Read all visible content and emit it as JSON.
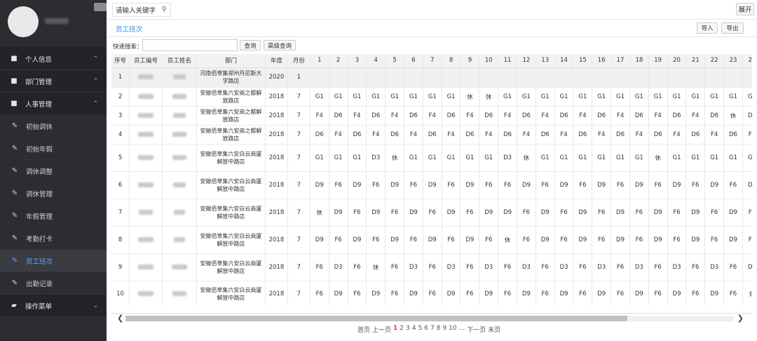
{
  "sidebar": {
    "items": [
      {
        "label": "个人信息",
        "icon": "folder-icon",
        "chev": "⌃",
        "type": "group"
      },
      {
        "label": "部门管理",
        "icon": "folder-icon",
        "chev": "⌃",
        "type": "group"
      },
      {
        "label": "人事管理",
        "icon": "folder-icon",
        "chev": "⌃",
        "type": "group"
      },
      {
        "label": "初始调休",
        "icon": "edit-icon",
        "type": "sub"
      },
      {
        "label": "初始年假",
        "icon": "edit-icon",
        "type": "sub"
      },
      {
        "label": "调休调整",
        "icon": "edit-icon",
        "type": "sub"
      },
      {
        "label": "调休管理",
        "icon": "edit-icon",
        "type": "sub"
      },
      {
        "label": "年假管理",
        "icon": "edit-icon",
        "type": "sub"
      },
      {
        "label": "考勤打卡",
        "icon": "edit-icon",
        "type": "sub"
      },
      {
        "label": "员工班次",
        "icon": "edit-icon",
        "type": "sub",
        "active": true
      },
      {
        "label": "出勤记录",
        "icon": "edit-icon",
        "type": "sub"
      },
      {
        "label": "操作菜单",
        "icon": "folder-open-icon",
        "chev": "⌄",
        "type": "group"
      }
    ]
  },
  "topbar": {
    "search_placeholder": "请输入关键字",
    "expand_label": "展开"
  },
  "tab": {
    "label": "员工班次",
    "import_label": "导入",
    "export_label": "导出"
  },
  "quick_search": {
    "label": "快速搜索：",
    "query_label": "查询",
    "advanced_label": "高级查询"
  },
  "table": {
    "headers": [
      "序号",
      "员工编号",
      "员工姓名",
      "部门",
      "年度",
      "月份",
      "1",
      "2",
      "3",
      "4",
      "5",
      "6",
      "7",
      "8",
      "9",
      "10",
      "11",
      "12",
      "13",
      "14",
      "15",
      "16",
      "17",
      "18",
      "19",
      "20",
      "21",
      "22",
      "23",
      "24"
    ],
    "rows": [
      {
        "no": "1",
        "dept": "河南佰草集郑州丹尼斯大学路店",
        "year": "2020",
        "month": "1",
        "days": []
      },
      {
        "no": "2",
        "dept": "安徽佰草集六安商之都解放路店",
        "year": "2018",
        "month": "7",
        "days": [
          "G1",
          "G1",
          "G1",
          "G1",
          "G1",
          "G1",
          "G1",
          "G1",
          "休",
          "休",
          "G1",
          "G1",
          "G1",
          "G1",
          "G1",
          "G1",
          "G1",
          "G1",
          "G1",
          "G1",
          "G1",
          "G1",
          "G1",
          "G1"
        ]
      },
      {
        "no": "3",
        "dept": "安徽佰草集六安商之都解放路店",
        "year": "2018",
        "month": "7",
        "days": [
          "F4",
          "D6",
          "F4",
          "D6",
          "F4",
          "D6",
          "F4",
          "D6",
          "F4",
          "D6",
          "F4",
          "D6",
          "F4",
          "D6",
          "F4",
          "D6",
          "F4",
          "D6",
          "F4",
          "D6",
          "F4",
          "D6",
          "休",
          "D6"
        ]
      },
      {
        "no": "4",
        "dept": "安徽佰草集六安商之都解放路店",
        "year": "2018",
        "month": "7",
        "days": [
          "D6",
          "F4",
          "D6",
          "F4",
          "D6",
          "F4",
          "D6",
          "F4",
          "D6",
          "F4",
          "D6",
          "F4",
          "D6",
          "F4",
          "D6",
          "F4",
          "D6",
          "F4",
          "D6",
          "F4",
          "D6",
          "F4",
          "D6",
          "F4"
        ]
      },
      {
        "no": "5",
        "dept": "安徽佰草集六安白云商厦解放中路店",
        "year": "2018",
        "month": "7",
        "days": [
          "G1",
          "G1",
          "G1",
          "D3",
          "休",
          "G1",
          "G1",
          "G1",
          "G1",
          "G1",
          "D3",
          "休",
          "G1",
          "G1",
          "G1",
          "G1",
          "G1",
          "G1",
          "休",
          "G1",
          "G1",
          "G1",
          "G1",
          "G1"
        ]
      },
      {
        "no": "6",
        "dept": "安徽佰草集六安白云商厦解放中路店",
        "year": "2018",
        "month": "7",
        "days": [
          "D9",
          "F6",
          "D9",
          "F6",
          "D9",
          "F6",
          "D9",
          "F6",
          "D9",
          "F6",
          "F6",
          "D9",
          "F6",
          "D9",
          "F6",
          "D9",
          "F6",
          "D9",
          "F6",
          "D9",
          "F6",
          "D9",
          "F6",
          "D9"
        ]
      },
      {
        "no": "7",
        "dept": "安徽佰草集六安白云商厦解放中路店",
        "year": "2018",
        "month": "7",
        "days": [
          "休",
          "D9",
          "F6",
          "D9",
          "F6",
          "D9",
          "F6",
          "D9",
          "F6",
          "D9",
          "D9",
          "F6",
          "D9",
          "F6",
          "D9",
          "F6",
          "D9",
          "F6",
          "D9",
          "F6",
          "D9",
          "F6",
          "D9",
          "F6"
        ]
      },
      {
        "no": "8",
        "dept": "安徽佰草集六安白云商厦解放中路店",
        "year": "2018",
        "month": "7",
        "days": [
          "D9",
          "F6",
          "D9",
          "F6",
          "D9",
          "F6",
          "D9",
          "F6",
          "D9",
          "F6",
          "休",
          "F6",
          "D9",
          "F6",
          "D9",
          "F6",
          "D9",
          "F6",
          "D9",
          "F6",
          "D9",
          "F6",
          "D9",
          "F6"
        ]
      },
      {
        "no": "9",
        "dept": "安徽佰草集六安白云商厦解放中路店",
        "year": "2018",
        "month": "7",
        "days": [
          "F6",
          "D3",
          "F6",
          "休",
          "F6",
          "D3",
          "F6",
          "D3",
          "F6",
          "D3",
          "F6",
          "D3",
          "F6",
          "D3",
          "F6",
          "D3",
          "F6",
          "D3",
          "F6",
          "D3",
          "F6",
          "D3",
          "F6",
          "D3"
        ]
      },
      {
        "no": "10",
        "dept": "安徽佰草集六安白云商厦解放中路店",
        "year": "2018",
        "month": "7",
        "days": [
          "F6",
          "D9",
          "F6",
          "D9",
          "F6",
          "D9",
          "F6",
          "D9",
          "F6",
          "D9",
          "F6",
          "D9",
          "F6",
          "D9",
          "F6",
          "D9",
          "F6",
          "D9",
          "F6",
          "D9",
          "F6",
          "D9",
          "F6",
          "休"
        ]
      }
    ]
  },
  "pager": {
    "first": "首页",
    "prev": "上一页",
    "pages": [
      "1",
      "2",
      "3",
      "4",
      "5",
      "6",
      "7",
      "8",
      "9",
      "10"
    ],
    "current": "1",
    "ellipsis": "...",
    "next": "下一页",
    "last": "末页"
  }
}
